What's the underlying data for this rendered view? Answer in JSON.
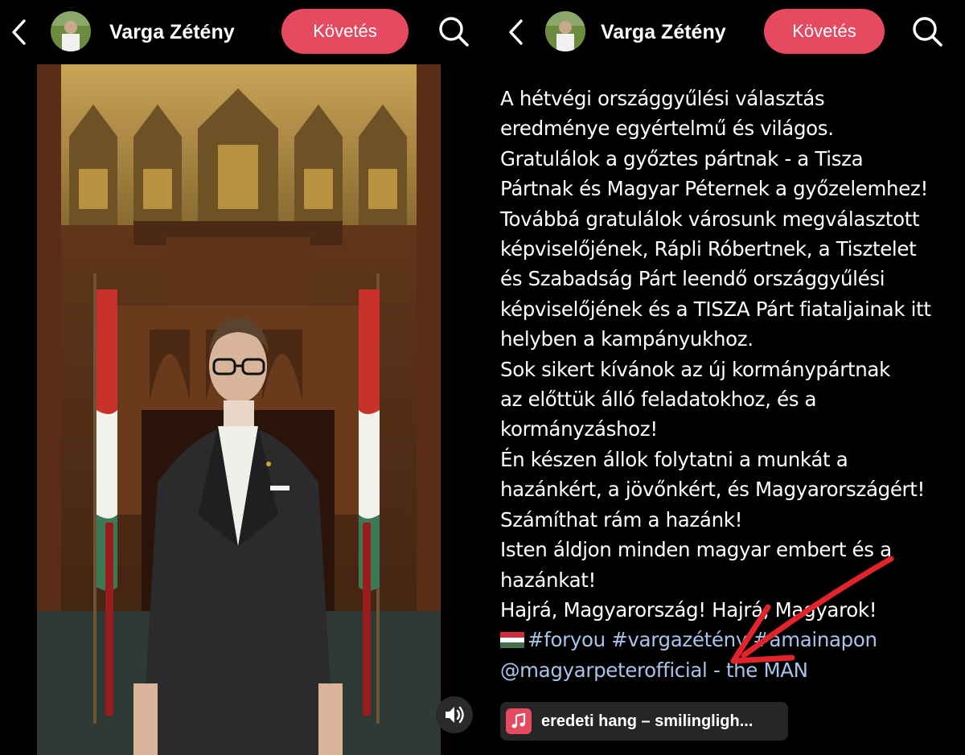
{
  "header": {
    "username": "Varga Zétény",
    "follow_label": "Követés"
  },
  "caption": {
    "lines": [
      "A hétvégi országgyűlési választás",
      "eredménye egyértelmű és világos.",
      "Gratulálok a győztes pártnak - a Tisza",
      "Pártnak és Magyar Péternek a győzelemhez!",
      "Továbbá gratulálok városunk megválasztott",
      "képviselőjének, Rápli Róbertnek, a Tisztelet",
      "és Szabadság Párt leendő országgyűlési",
      "képviselőjének és a TISZA Párt fiataljainak itt",
      "helyben a kampányukhoz.",
      "Sok sikert kívánok az új kormánypártnak",
      "az előttük álló feladatokhoz, és a",
      "kormányzáshoz!",
      "Én készen állok folytatni a munkát a",
      "hazánkért, a jövőnkért, és Magyarországért!",
      "Számíthat rám a hazánk!",
      "Isten áldjon minden magyar embert és a",
      "hazánkat!",
      "Hajrá, Magyarország! Hajrá, Magyarok!"
    ],
    "hashtags": "#foryou #vargazétény #amainapon",
    "mention": "@magyarpeterofficial - the MAN"
  },
  "music": {
    "label": "eredeti hang – smilingligh..."
  },
  "icons": {
    "back": "chevron-left-icon",
    "search": "search-icon",
    "sound": "speaker-icon",
    "music": "music-note-icon",
    "flag": "hungary-flag-icon"
  },
  "colors": {
    "follow_button": "#e54a60",
    "hashtag": "#a9c3eb",
    "arrow": "#e0242c"
  }
}
